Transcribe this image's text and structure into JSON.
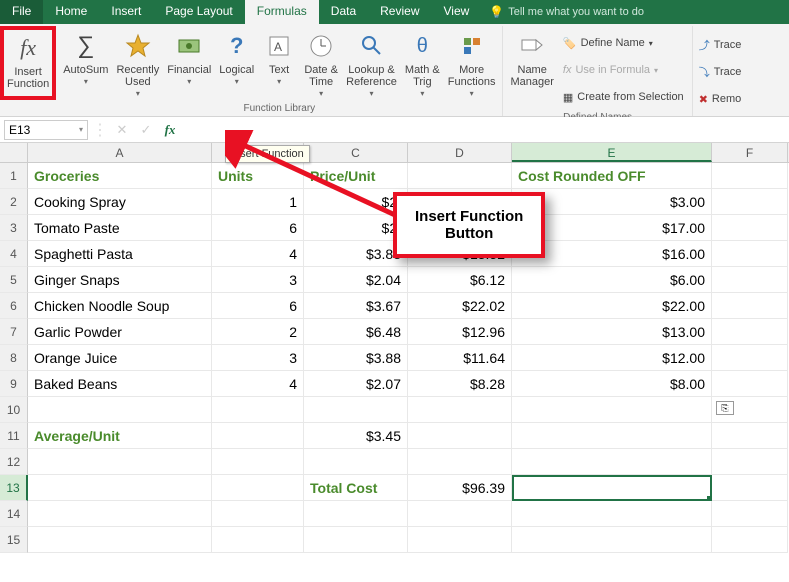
{
  "tabs": {
    "file": "File",
    "home": "Home",
    "insert": "Insert",
    "page_layout": "Page Layout",
    "formulas": "Formulas",
    "data": "Data",
    "review": "Review",
    "view": "View",
    "tell_me": "Tell me what you want to do"
  },
  "ribbon": {
    "insert_function": "Insert\nFunction",
    "autosum": "AutoSum",
    "recently_used": "Recently\nUsed",
    "financial": "Financial",
    "logical": "Logical",
    "text": "Text",
    "date_time": "Date &\nTime",
    "lookup_ref": "Lookup &\nReference",
    "math_trig": "Math &\nTrig",
    "more_fn": "More\nFunctions",
    "group_library": "Function Library",
    "name_manager": "Name\nManager",
    "define_name": "Define Name",
    "use_in_formula": "Use in Formula",
    "create_from_sel": "Create from Selection",
    "group_defined": "Defined Names",
    "trace1": "Trace",
    "trace2": "Trace",
    "remo": "Remo"
  },
  "formula_bar": {
    "name_box": "E13",
    "tooltip": "Insert Function"
  },
  "callout": {
    "line1": "Insert Function",
    "line2": "Button"
  },
  "columns": [
    "A",
    "B",
    "C",
    "D",
    "E",
    "F"
  ],
  "sheet": {
    "r1": {
      "A": "Groceries",
      "B": "Units",
      "C": "Price/Unit",
      "E": "Cost Rounded OFF"
    },
    "r2": {
      "A": "Cooking Spray",
      "B": "1",
      "C": "$2.",
      "E": "$3.00"
    },
    "r3": {
      "A": "Tomato Paste",
      "B": "6",
      "C": "$2.",
      "E": "$17.00"
    },
    "r4": {
      "A": "Spaghetti Pasta",
      "B": "4",
      "C": "$3.88",
      "D": "$15.52",
      "E": "$16.00"
    },
    "r5": {
      "A": "Ginger Snaps",
      "B": "3",
      "C": "$2.04",
      "D": "$6.12",
      "E": "$6.00"
    },
    "r6": {
      "A": "Chicken Noodle Soup",
      "B": "6",
      "C": "$3.67",
      "D": "$22.02",
      "E": "$22.00"
    },
    "r7": {
      "A": "Garlic Powder",
      "B": "2",
      "C": "$6.48",
      "D": "$12.96",
      "E": "$13.00"
    },
    "r8": {
      "A": "Orange Juice",
      "B": "3",
      "C": "$3.88",
      "D": "$11.64",
      "E": "$12.00"
    },
    "r9": {
      "A": "Baked Beans",
      "B": "4",
      "C": "$2.07",
      "D": "$8.28",
      "E": "$8.00"
    },
    "r11": {
      "A": "Average/Unit",
      "C": "$3.45"
    },
    "r13": {
      "C": "Total Cost",
      "D": "$96.39"
    }
  }
}
